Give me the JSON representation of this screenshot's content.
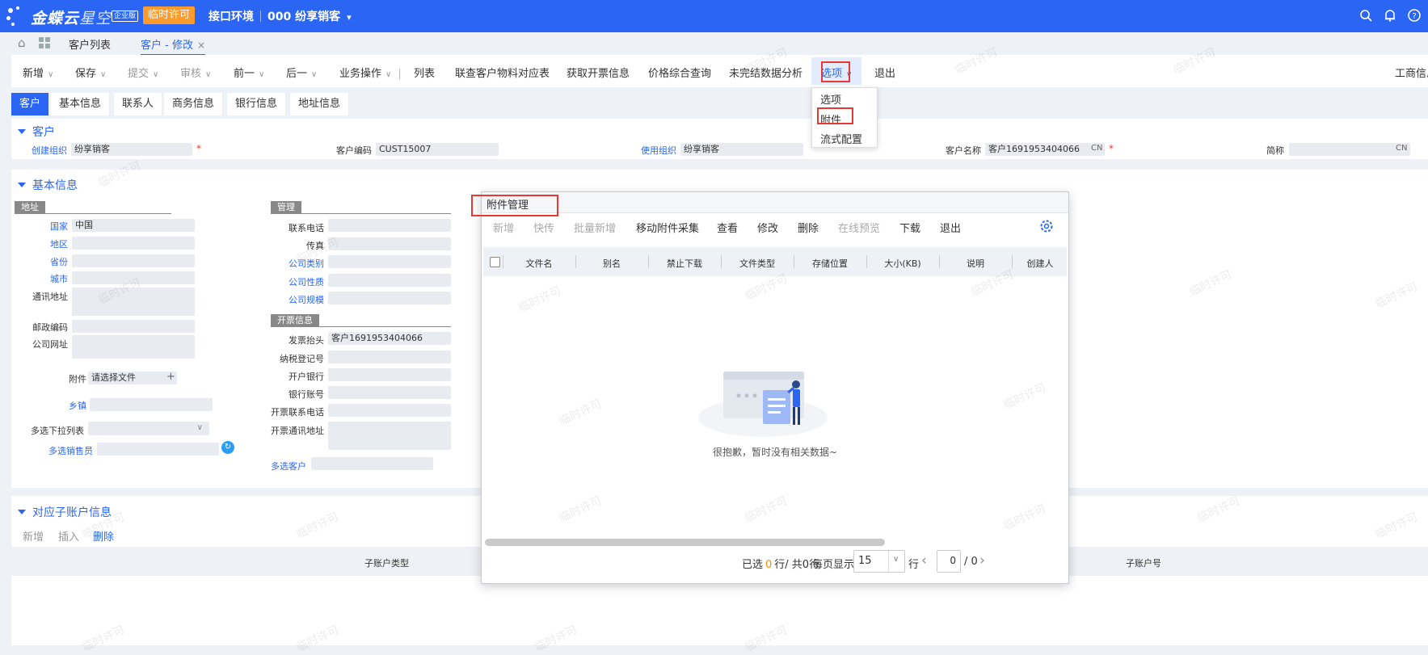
{
  "topbar": {
    "brand_main": "金蝶云",
    "brand_sub": "星空",
    "edition": "企业版",
    "license": "临时许可",
    "env_label": "接口环境",
    "org": "000 纷享销客"
  },
  "tabs": [
    "客户列表",
    "客户 - 修改"
  ],
  "toolbar": {
    "items": [
      "新增",
      "保存",
      "提交",
      "审核",
      "前一",
      "后一",
      "业务操作",
      "列表",
      "联查客户物料对应表",
      "获取开票信息",
      "价格综合查询",
      "未完结数据分析",
      "选项",
      "退出"
    ],
    "right": "工商信息"
  },
  "options_menu": [
    "选项",
    "附件",
    "流式配置"
  ],
  "subtabs": [
    "客户",
    "基本信息",
    "联系人",
    "商务信息",
    "银行信息",
    "地址信息"
  ],
  "customer": {
    "title": "客户",
    "create_org_label": "创建组织",
    "create_org": "纷享销客",
    "code_label": "客户编码",
    "code": "CUST15007",
    "use_org_label": "使用组织",
    "use_org": "纷享销客",
    "name_label": "客户名称",
    "name": "客户1691953404066",
    "name_lang": "CN",
    "short_label": "简称",
    "short_lang": "CN",
    "required_mark": "*"
  },
  "basic": {
    "title": "基本信息",
    "address_group": "地址",
    "country_label": "国家",
    "country": "中国",
    "region_label": "地区",
    "province_label": "省份",
    "city_label": "城市",
    "mail_addr_label": "通讯地址",
    "zip_label": "邮政编码",
    "website_label": "公司网址",
    "attach_label": "附件",
    "attach_value": "请选择文件",
    "plus": "+",
    "town_label": "乡镇",
    "multi_dropdown_label": "多选下拉列表",
    "multi_sales_label": "多选销售员",
    "manage_group": "管理",
    "phone_label": "联系电话",
    "fax_label": "传真",
    "company_type_label": "公司类别",
    "company_nature_label": "公司性质",
    "company_scale_label": "公司规模",
    "invoice_group": "开票信息",
    "invoice_title_label": "发票抬头",
    "invoice_title": "客户1691953404066",
    "tax_no_label": "纳税登记号",
    "bank_label": "开户银行",
    "bank_acct_label": "银行账号",
    "invoice_phone_label": "开票联系电话",
    "invoice_addr_label": "开票通讯地址",
    "multi_customer_label": "多选客户"
  },
  "sub_account": {
    "title": "对应子账户信息",
    "actions": [
      "新增",
      "插入",
      "删除"
    ],
    "col_type": "子账户类型",
    "col_no": "子账户号"
  },
  "dialog": {
    "title": "附件管理",
    "close": "×",
    "actions": [
      "新增",
      "快传",
      "批量新增",
      "移动附件采集",
      "查看",
      "修改",
      "删除",
      "在线预览",
      "下载",
      "退出"
    ],
    "columns": [
      "文件名",
      "别名",
      "禁止下载",
      "文件类型",
      "存储位置",
      "大小(KB)",
      "说明",
      "创建人"
    ],
    "empty": "很抱歉，暂时没有相关数据~",
    "pager": {
      "selected_prefix": "已选",
      "selected_count": "0",
      "selected_suffix": "行/ 共0行",
      "per_page_label": "每页显示",
      "per_page": "15",
      "row_unit": "行",
      "page_current": "0",
      "page_total": "/ 0"
    }
  },
  "watermark": "临时许可",
  "colors": {
    "primary": "#2a66f3",
    "license": "#ff9a2b",
    "highlight": "#e53935",
    "count": "#ff8c00"
  }
}
